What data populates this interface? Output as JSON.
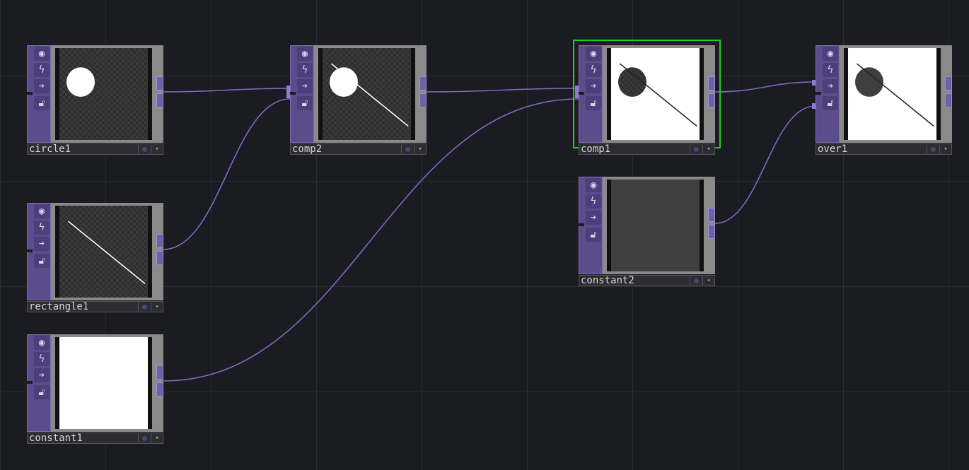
{
  "network": {
    "nodes": [
      {
        "id": "circle1",
        "label": "circle1",
        "content": "circle",
        "selected": false
      },
      {
        "id": "rectangle1",
        "label": "rectangle1",
        "content": "line",
        "selected": false
      },
      {
        "id": "constant1",
        "label": "constant1",
        "content": "white",
        "selected": false
      },
      {
        "id": "comp2",
        "label": "comp2",
        "content": "circle_line",
        "selected": false
      },
      {
        "id": "comp1",
        "label": "comp1",
        "content": "white_comp",
        "selected": true
      },
      {
        "id": "constant2",
        "label": "constant2",
        "content": "grey",
        "selected": false
      },
      {
        "id": "over1",
        "label": "over1",
        "content": "white_over",
        "selected": false
      }
    ],
    "connections": [
      {
        "from": "circle1",
        "to": "comp2",
        "input": 1
      },
      {
        "from": "rectangle1",
        "to": "comp2",
        "input": 2
      },
      {
        "from": "comp2",
        "to": "comp1",
        "input": 1
      },
      {
        "from": "constant1",
        "to": "comp1",
        "input": 2
      },
      {
        "from": "comp1",
        "to": "over1",
        "input": 1
      },
      {
        "from": "constant2",
        "to": "over1",
        "input": 2
      }
    ]
  },
  "node_icons": [
    "viewer-toggle-icon",
    "bypass-icon",
    "render-flag-icon",
    "lock-icon"
  ],
  "colors": {
    "background": "#1b1c21",
    "wire": "#7b6bc0",
    "node_side": "#5b4d8c",
    "selection": "#1fcf22"
  }
}
